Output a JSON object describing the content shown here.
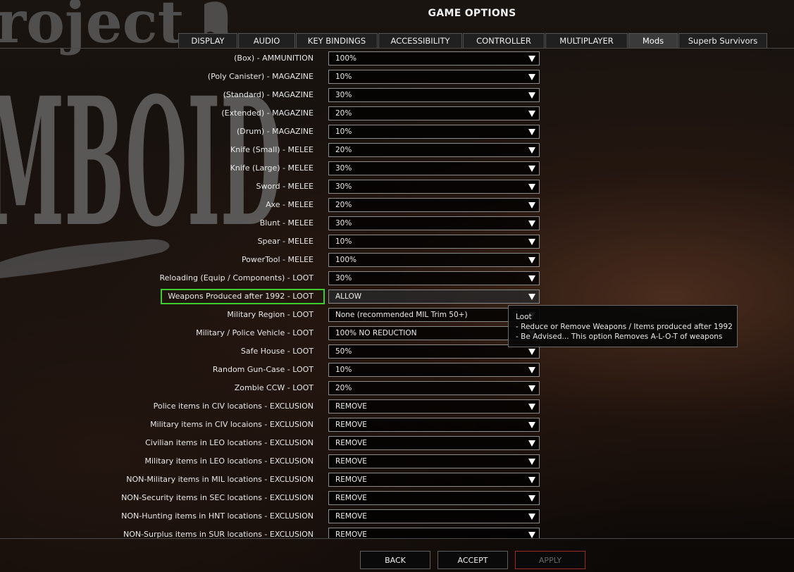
{
  "window": {
    "title": "GAME OPTIONS"
  },
  "background": {
    "logo_top": "roject",
    "logo_main": "MBOID"
  },
  "tabs": [
    {
      "label": "DISPLAY",
      "active": false
    },
    {
      "label": "AUDIO",
      "active": false
    },
    {
      "label": "KEY BINDINGS",
      "active": false
    },
    {
      "label": "ACCESSIBILITY",
      "active": false
    },
    {
      "label": "CONTROLLER",
      "active": false
    },
    {
      "label": "MULTIPLAYER",
      "active": false
    },
    {
      "label": "Mods",
      "active": true
    },
    {
      "label": "Superb Survivors",
      "active": false
    }
  ],
  "options": [
    {
      "label": "(Box) - AMMUNITION",
      "value": "100%"
    },
    {
      "label": "(Poly Canister) - MAGAZINE",
      "value": "10%"
    },
    {
      "label": "(Standard) - MAGAZINE",
      "value": "30%"
    },
    {
      "label": "(Extended) - MAGAZINE",
      "value": "20%"
    },
    {
      "label": "(Drum) - MAGAZINE",
      "value": "10%"
    },
    {
      "label": "Knife (Small) - MELEE",
      "value": "20%"
    },
    {
      "label": "Knife (Large) - MELEE",
      "value": "30%"
    },
    {
      "label": "Sword - MELEE",
      "value": "30%"
    },
    {
      "label": "Axe - MELEE",
      "value": "20%"
    },
    {
      "label": "Blunt - MELEE",
      "value": "30%"
    },
    {
      "label": "Spear - MELEE",
      "value": "10%"
    },
    {
      "label": "PowerTool - MELEE",
      "value": "100%"
    },
    {
      "label": "Reloading (Equip / Components) - LOOT",
      "value": "30%"
    },
    {
      "label": "Weapons Produced after 1992 - LOOT",
      "value": "ALLOW",
      "highlighted": true
    },
    {
      "label": "Military Region - LOOT",
      "value": "None (recommended MIL Trim 50+)"
    },
    {
      "label": "Military / Police Vehicle - LOOT",
      "value": "100% NO REDUCTION"
    },
    {
      "label": "Safe House - LOOT",
      "value": "50%"
    },
    {
      "label": "Random Gun-Case - LOOT",
      "value": "10%"
    },
    {
      "label": "Zombie CCW - LOOT",
      "value": "20%"
    },
    {
      "label": "Police  items in CIV locations - EXCLUSION",
      "value": "REMOVE"
    },
    {
      "label": "Military items in CIV locaions - EXCLUSION",
      "value": "REMOVE"
    },
    {
      "label": "Civilian items in LEO locations - EXCLUSION",
      "value": "REMOVE"
    },
    {
      "label": "Military items in LEO locations - EXCLUSION",
      "value": "REMOVE"
    },
    {
      "label": "NON-Military items in MIL locations - EXCLUSION",
      "value": "REMOVE"
    },
    {
      "label": "NON-Security items in SEC locations - EXCLUSION",
      "value": "REMOVE"
    },
    {
      "label": "NON-Hunting items in HNT locations - EXCLUSION",
      "value": "REMOVE"
    },
    {
      "label": "NON-Surplus items in SUR locations - EXCLUSION",
      "value": "REMOVE"
    }
  ],
  "tooltip": {
    "title": "Loot",
    "lines": [
      "- Reduce or Remove Weapons / Items produced after 1992",
      "- Be Advised... This option Removes A-L-O-T of weapons"
    ]
  },
  "buttons": {
    "back": "BACK",
    "accept": "ACCEPT",
    "apply": "APPLY"
  },
  "colors": {
    "highlight_border": "#3fcc2e",
    "apply_disabled_border": "#9b2a2a"
  }
}
